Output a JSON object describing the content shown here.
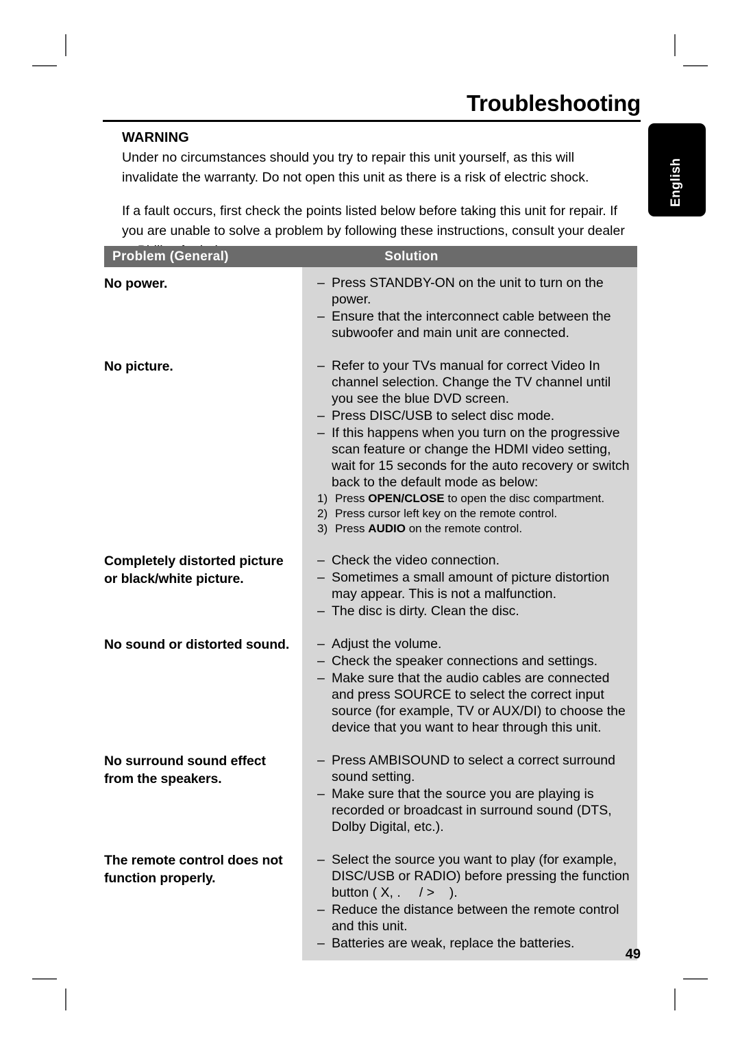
{
  "page": {
    "title": "Troubleshooting",
    "number": "49",
    "language_tab": "English"
  },
  "intro": {
    "warning_heading": "WARNING",
    "warning_text": "Under no circumstances should you try to repair this unit yourself, as this will invalidate the warranty. Do not open this unit as there is a risk of electric shock.",
    "advice_text": "If a fault occurs, first check the points listed below before taking this unit for repair. If you are unable to solve a problem by following these instructions, consult your dealer or Philips for help."
  },
  "table": {
    "headers": {
      "problem": "Problem (General)",
      "solution": "Solution"
    },
    "dash": "–",
    "rows": [
      {
        "problem": "No power.",
        "solutions": [
          "Press STANDBY-ON on the unit to turn on the power.",
          "Ensure that the interconnect cable between the subwoofer and main unit are connected."
        ]
      },
      {
        "problem": "No picture.",
        "solutions": [
          "Refer to your TVs manual for correct Video In channel selection. Change the TV channel until you see the blue DVD screen.",
          "Press DISC/USB to select disc mode.",
          "If this happens when you turn on the progressive scan feature or change the HDMI video setting, wait for 15 seconds for the auto recovery or switch back to the default mode as below:"
        ],
        "sub_list": [
          {
            "num": "1)",
            "pre": "Press ",
            "bold": "OPEN/CLOSE",
            "post": " to open the disc compartment."
          },
          {
            "num": "2)",
            "pre": "Press cursor left key on the remote control.",
            "bold": "",
            "post": ""
          },
          {
            "num": "3)",
            "pre": "Press ",
            "bold": "AUDIO",
            "post": " on the remote control."
          }
        ]
      },
      {
        "problem": "Completely distorted picture or black/white picture.",
        "solutions": [
          "Check the video connection.",
          "Sometimes a small amount of picture distortion may appear. This is not a malfunction.",
          "The disc is dirty. Clean the disc."
        ]
      },
      {
        "problem": "No sound or distorted sound.",
        "solutions": [
          "Adjust the volume.",
          "Check the speaker connections and settings.",
          "Make sure that the audio cables are connected and press SOURCE to select the correct input source (for example, TV or AUX/DI) to choose the device that you want to hear through this unit."
        ]
      },
      {
        "problem": "No surround sound effect from the speakers.",
        "solutions": [
          "Press AMBISOUND to select a correct surround sound setting.",
          "Make sure that the source you are playing is recorded or broadcast in surround sound (DTS, Dolby Digital, etc.)."
        ]
      },
      {
        "problem": "The remote control does not function properly.",
        "solutions": [
          "Select the source you want to play (for example, DISC/USB or RADIO) before pressing the function button ( X, .     / >    ).",
          "Reduce the distance between the remote control and this unit.",
          "Batteries are weak, replace the batteries."
        ]
      }
    ]
  },
  "colors": {
    "header_bar": "#6b6b6b",
    "solution_bg": "#d6d6d6",
    "tab_bg": "#000000"
  }
}
